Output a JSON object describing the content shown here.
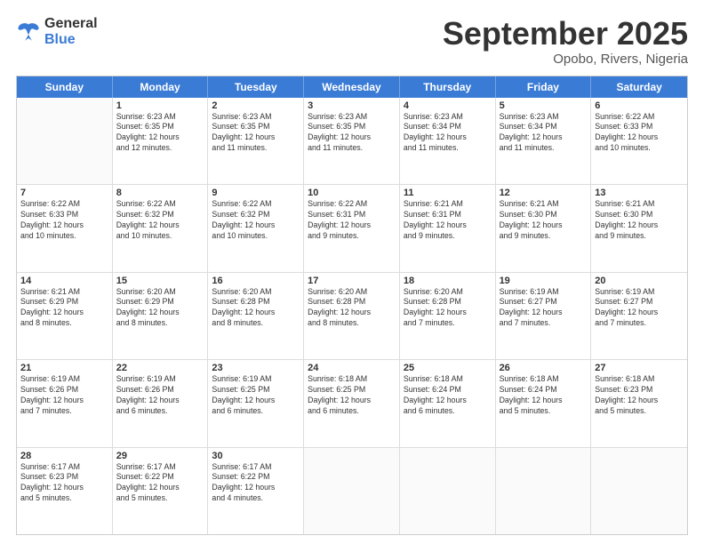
{
  "header": {
    "logo_line1": "General",
    "logo_line2": "Blue",
    "month": "September 2025",
    "location": "Opobo, Rivers, Nigeria"
  },
  "weekdays": [
    "Sunday",
    "Monday",
    "Tuesday",
    "Wednesday",
    "Thursday",
    "Friday",
    "Saturday"
  ],
  "rows": [
    [
      {
        "day": "",
        "info": ""
      },
      {
        "day": "1",
        "info": "Sunrise: 6:23 AM\nSunset: 6:35 PM\nDaylight: 12 hours\nand 12 minutes."
      },
      {
        "day": "2",
        "info": "Sunrise: 6:23 AM\nSunset: 6:35 PM\nDaylight: 12 hours\nand 11 minutes."
      },
      {
        "day": "3",
        "info": "Sunrise: 6:23 AM\nSunset: 6:35 PM\nDaylight: 12 hours\nand 11 minutes."
      },
      {
        "day": "4",
        "info": "Sunrise: 6:23 AM\nSunset: 6:34 PM\nDaylight: 12 hours\nand 11 minutes."
      },
      {
        "day": "5",
        "info": "Sunrise: 6:23 AM\nSunset: 6:34 PM\nDaylight: 12 hours\nand 11 minutes."
      },
      {
        "day": "6",
        "info": "Sunrise: 6:22 AM\nSunset: 6:33 PM\nDaylight: 12 hours\nand 10 minutes."
      }
    ],
    [
      {
        "day": "7",
        "info": "Sunrise: 6:22 AM\nSunset: 6:33 PM\nDaylight: 12 hours\nand 10 minutes."
      },
      {
        "day": "8",
        "info": "Sunrise: 6:22 AM\nSunset: 6:32 PM\nDaylight: 12 hours\nand 10 minutes."
      },
      {
        "day": "9",
        "info": "Sunrise: 6:22 AM\nSunset: 6:32 PM\nDaylight: 12 hours\nand 10 minutes."
      },
      {
        "day": "10",
        "info": "Sunrise: 6:22 AM\nSunset: 6:31 PM\nDaylight: 12 hours\nand 9 minutes."
      },
      {
        "day": "11",
        "info": "Sunrise: 6:21 AM\nSunset: 6:31 PM\nDaylight: 12 hours\nand 9 minutes."
      },
      {
        "day": "12",
        "info": "Sunrise: 6:21 AM\nSunset: 6:30 PM\nDaylight: 12 hours\nand 9 minutes."
      },
      {
        "day": "13",
        "info": "Sunrise: 6:21 AM\nSunset: 6:30 PM\nDaylight: 12 hours\nand 9 minutes."
      }
    ],
    [
      {
        "day": "14",
        "info": "Sunrise: 6:21 AM\nSunset: 6:29 PM\nDaylight: 12 hours\nand 8 minutes."
      },
      {
        "day": "15",
        "info": "Sunrise: 6:20 AM\nSunset: 6:29 PM\nDaylight: 12 hours\nand 8 minutes."
      },
      {
        "day": "16",
        "info": "Sunrise: 6:20 AM\nSunset: 6:28 PM\nDaylight: 12 hours\nand 8 minutes."
      },
      {
        "day": "17",
        "info": "Sunrise: 6:20 AM\nSunset: 6:28 PM\nDaylight: 12 hours\nand 8 minutes."
      },
      {
        "day": "18",
        "info": "Sunrise: 6:20 AM\nSunset: 6:28 PM\nDaylight: 12 hours\nand 7 minutes."
      },
      {
        "day": "19",
        "info": "Sunrise: 6:19 AM\nSunset: 6:27 PM\nDaylight: 12 hours\nand 7 minutes."
      },
      {
        "day": "20",
        "info": "Sunrise: 6:19 AM\nSunset: 6:27 PM\nDaylight: 12 hours\nand 7 minutes."
      }
    ],
    [
      {
        "day": "21",
        "info": "Sunrise: 6:19 AM\nSunset: 6:26 PM\nDaylight: 12 hours\nand 7 minutes."
      },
      {
        "day": "22",
        "info": "Sunrise: 6:19 AM\nSunset: 6:26 PM\nDaylight: 12 hours\nand 6 minutes."
      },
      {
        "day": "23",
        "info": "Sunrise: 6:19 AM\nSunset: 6:25 PM\nDaylight: 12 hours\nand 6 minutes."
      },
      {
        "day": "24",
        "info": "Sunrise: 6:18 AM\nSunset: 6:25 PM\nDaylight: 12 hours\nand 6 minutes."
      },
      {
        "day": "25",
        "info": "Sunrise: 6:18 AM\nSunset: 6:24 PM\nDaylight: 12 hours\nand 6 minutes."
      },
      {
        "day": "26",
        "info": "Sunrise: 6:18 AM\nSunset: 6:24 PM\nDaylight: 12 hours\nand 5 minutes."
      },
      {
        "day": "27",
        "info": "Sunrise: 6:18 AM\nSunset: 6:23 PM\nDaylight: 12 hours\nand 5 minutes."
      }
    ],
    [
      {
        "day": "28",
        "info": "Sunrise: 6:17 AM\nSunset: 6:23 PM\nDaylight: 12 hours\nand 5 minutes."
      },
      {
        "day": "29",
        "info": "Sunrise: 6:17 AM\nSunset: 6:22 PM\nDaylight: 12 hours\nand 5 minutes."
      },
      {
        "day": "30",
        "info": "Sunrise: 6:17 AM\nSunset: 6:22 PM\nDaylight: 12 hours\nand 4 minutes."
      },
      {
        "day": "",
        "info": ""
      },
      {
        "day": "",
        "info": ""
      },
      {
        "day": "",
        "info": ""
      },
      {
        "day": "",
        "info": ""
      }
    ]
  ]
}
